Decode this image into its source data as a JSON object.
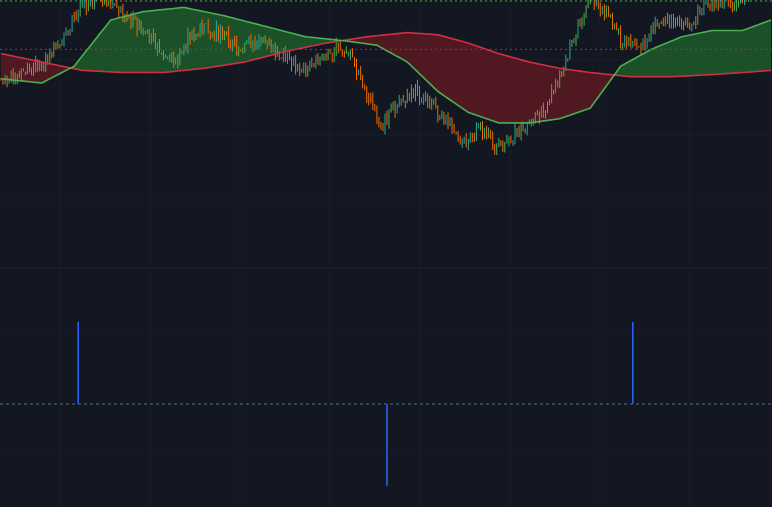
{
  "chart_data": [
    {
      "type": "candlestick",
      "pane": "price",
      "x_count": 380,
      "ylim": [
        0,
        100
      ],
      "grid": true,
      "reference_level": 86,
      "colors": {
        "up": "#26a69a",
        "up_alt": "#4caf50",
        "down": "#ef6c00",
        "fast_ma": "#4caf50",
        "slow_ma": "#d32f43",
        "fill_bull": "#1f5a2a",
        "fill_bear": "#5c1a22",
        "reference_line": "#c2185b"
      },
      "price_path": [
        [
          0,
          72
        ],
        [
          10,
          74
        ],
        [
          20,
          80
        ],
        [
          30,
          92
        ],
        [
          36,
          100
        ],
        [
          42,
          108
        ],
        [
          48,
          112
        ],
        [
          56,
          106
        ],
        [
          64,
          100
        ],
        [
          72,
          94
        ],
        [
          80,
          84
        ],
        [
          86,
          80
        ],
        [
          92,
          92
        ],
        [
          100,
          96
        ],
        [
          108,
          94
        ],
        [
          116,
          86
        ],
        [
          124,
          90
        ],
        [
          132,
          88
        ],
        [
          140,
          82
        ],
        [
          148,
          76
        ],
        [
          156,
          82
        ],
        [
          164,
          86
        ],
        [
          172,
          84
        ],
        [
          180,
          64
        ],
        [
          188,
          50
        ],
        [
          196,
          60
        ],
        [
          204,
          66
        ],
        [
          212,
          60
        ],
        [
          220,
          50
        ],
        [
          228,
          42
        ],
        [
          236,
          48
        ],
        [
          244,
          40
        ],
        [
          252,
          44
        ],
        [
          260,
          52
        ],
        [
          268,
          58
        ],
        [
          276,
          76
        ],
        [
          284,
          96
        ],
        [
          290,
          110
        ],
        [
          298,
          104
        ],
        [
          306,
          90
        ],
        [
          314,
          86
        ],
        [
          322,
          98
        ],
        [
          330,
          100
        ],
        [
          338,
          96
        ],
        [
          346,
          106
        ],
        [
          354,
          110
        ],
        [
          362,
          108
        ],
        [
          370,
          116
        ],
        [
          379,
          120
        ]
      ],
      "fast_ma": [
        [
          0,
          72
        ],
        [
          20,
          70
        ],
        [
          36,
          78
        ],
        [
          54,
          100
        ],
        [
          70,
          104
        ],
        [
          90,
          106
        ],
        [
          110,
          102
        ],
        [
          130,
          97
        ],
        [
          150,
          92
        ],
        [
          170,
          90
        ],
        [
          185,
          88
        ],
        [
          200,
          80
        ],
        [
          215,
          66
        ],
        [
          230,
          56
        ],
        [
          245,
          51
        ],
        [
          260,
          51
        ],
        [
          275,
          53
        ],
        [
          290,
          58
        ],
        [
          305,
          78
        ],
        [
          320,
          86
        ],
        [
          335,
          92
        ],
        [
          350,
          95
        ],
        [
          365,
          95
        ],
        [
          379,
          100
        ]
      ],
      "slow_ma": [
        [
          0,
          84
        ],
        [
          20,
          80
        ],
        [
          40,
          76
        ],
        [
          60,
          75
        ],
        [
          80,
          75
        ],
        [
          100,
          77
        ],
        [
          120,
          80
        ],
        [
          140,
          85
        ],
        [
          160,
          89
        ],
        [
          180,
          92
        ],
        [
          200,
          94
        ],
        [
          215,
          93
        ],
        [
          230,
          89
        ],
        [
          245,
          84
        ],
        [
          260,
          80
        ],
        [
          275,
          77
        ],
        [
          290,
          75
        ],
        [
          310,
          73
        ],
        [
          330,
          73
        ],
        [
          350,
          74
        ],
        [
          365,
          75
        ],
        [
          379,
          76
        ]
      ]
    },
    {
      "type": "bar",
      "pane": "signal",
      "x_count": 380,
      "ylim": [
        -1.05,
        1.05
      ],
      "baseline": 0,
      "colors": {
        "bar": "#2962ff",
        "baseline": "#5b6b80"
      },
      "points": [
        {
          "x": 38,
          "value": 1
        },
        {
          "x": 190,
          "value": -1
        },
        {
          "x": 311,
          "value": 1
        }
      ]
    }
  ]
}
